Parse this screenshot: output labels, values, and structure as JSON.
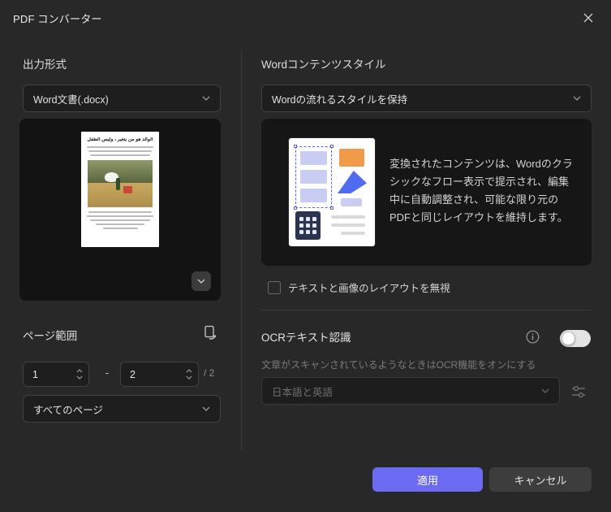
{
  "window": {
    "title": "PDF コンバーター"
  },
  "left": {
    "output_format_label": "出力形式",
    "format_value": "Word文書(.docx)",
    "preview_title": "الوالد هو من يتغير ، وليس الطفل",
    "page_range_label": "ページ範囲",
    "range_from": "1",
    "range_sep": "-",
    "range_to": "2",
    "range_total": "/ 2",
    "pages_value": "すべてのページ"
  },
  "right": {
    "style_label": "Wordコンテンツスタイル",
    "style_value": "Wordの流れるスタイルを保持",
    "style_description": "変換されたコンテンツは、Wordのクラシックなフロー表示で提示され、編集中に自動調整され、可能な限り元のPDFと同じレイアウトを維持します。",
    "ignore_layout_label": "テキストと画像のレイアウトを無視",
    "ocr_label": "OCRテキスト認識",
    "ocr_enabled": false,
    "ocr_hint": "文章がスキャンされているようなときはOCR機能をオンにする",
    "ocr_language_value": "日本語と英語"
  },
  "footer": {
    "apply_label": "適用",
    "cancel_label": "キャンセル"
  },
  "colors": {
    "accent": "#6a6af2",
    "dialog_bg": "#282828",
    "panel_bg": "#161616"
  }
}
